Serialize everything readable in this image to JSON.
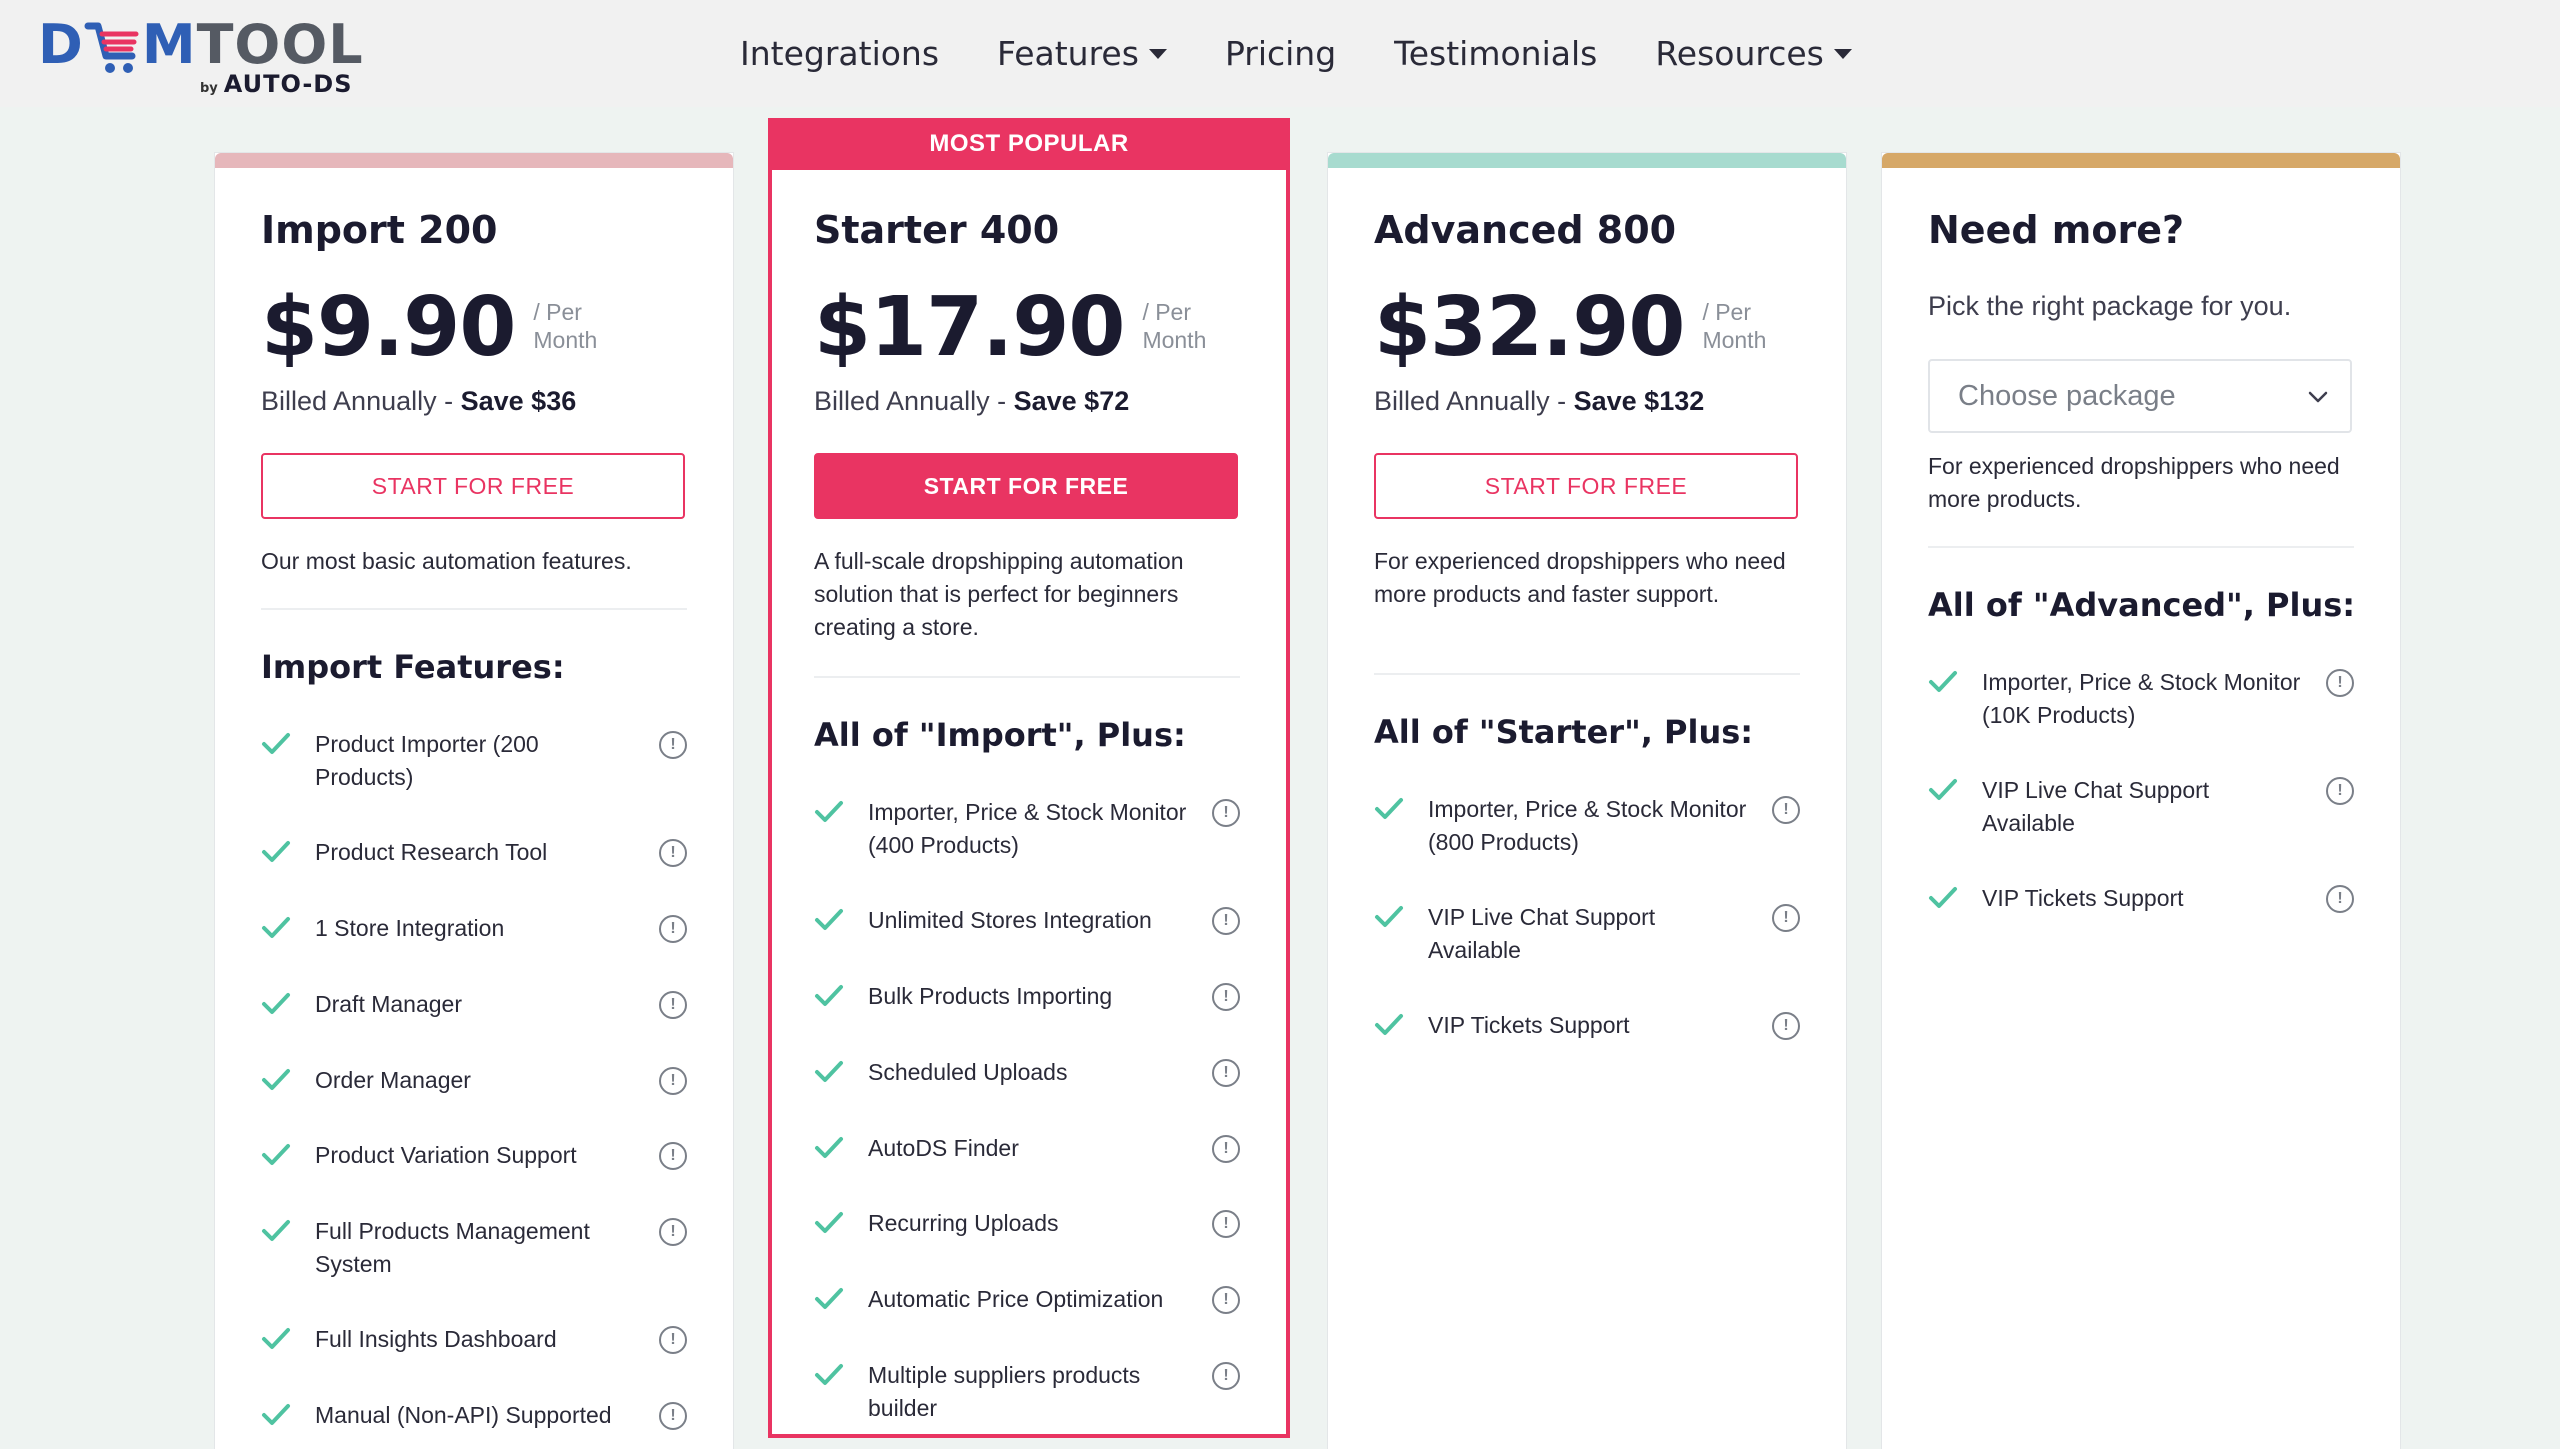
{
  "brand": {
    "name_part1": "D",
    "name_part2": "M",
    "name_part3": "TOOL",
    "by": "by",
    "auto": "AUTO",
    "ds": "DS"
  },
  "nav": {
    "items": [
      {
        "label": "Integrations"
      },
      {
        "label": "Features"
      },
      {
        "label": "Pricing"
      },
      {
        "label": "Testimonials"
      },
      {
        "label": "Resources"
      }
    ]
  },
  "colors": {
    "accent": "#e93462",
    "import": "#e6b7bb",
    "advanced": "#a7dbcf",
    "more": "#d6a868",
    "check": "#4fc3a1"
  },
  "plans": [
    {
      "title": "Import 200",
      "price": "$9.90",
      "per_line1": "/ Per",
      "per_line2": "Month",
      "billed": "Billed Annually - ",
      "save": "Save $36",
      "button": "START FOR FREE",
      "desc": "Our most basic automation features.",
      "section_title": "Import Features:",
      "features": [
        "Product Importer (200 Products)",
        "Product Research Tool",
        "1 Store Integration",
        "Draft Manager",
        "Order Manager",
        "Product Variation Support",
        "Full Products Management System",
        "Full Insights Dashboard",
        "Manual (Non-API) Supported"
      ]
    },
    {
      "badge": "MOST POPULAR",
      "title": "Starter 400",
      "price": "$17.90",
      "per_line1": "/ Per",
      "per_line2": "Month",
      "billed": "Billed Annually - ",
      "save": "Save $72",
      "button": "START FOR FREE",
      "desc": "A full-scale dropshipping automation solution that is perfect for beginners creating a store.",
      "section_title": "All of \"Import\", Plus:",
      "features": [
        "Importer, Price & Stock Monitor (400 Products)",
        "Unlimited Stores Integration",
        "Bulk Products Importing",
        "Scheduled Uploads",
        "AutoDS Finder",
        "Recurring Uploads",
        "Automatic Price Optimization",
        "Multiple suppliers products builder"
      ]
    },
    {
      "title": "Advanced 800",
      "price": "$32.90",
      "per_line1": "/ Per",
      "per_line2": "Month",
      "billed": "Billed Annually - ",
      "save": "Save $132",
      "button": "START FOR FREE",
      "desc": "For experienced dropshippers who need more products and faster support.",
      "section_title": "All of \"Starter\", Plus:",
      "features": [
        "Importer, Price & Stock Monitor (800 Products)",
        "VIP Live Chat Support Available",
        "VIP Tickets Support"
      ]
    },
    {
      "title": "Need more?",
      "subtitle": "Pick the right package for you.",
      "select_placeholder": "Choose package",
      "desc": "For experienced dropshippers who need more products.",
      "section_title": "All of \"Advanced\", Plus:",
      "features": [
        "Importer, Price & Stock Monitor (10K Products)",
        "VIP Live Chat Support Available",
        "VIP Tickets Support"
      ]
    }
  ],
  "info_glyph": "!"
}
